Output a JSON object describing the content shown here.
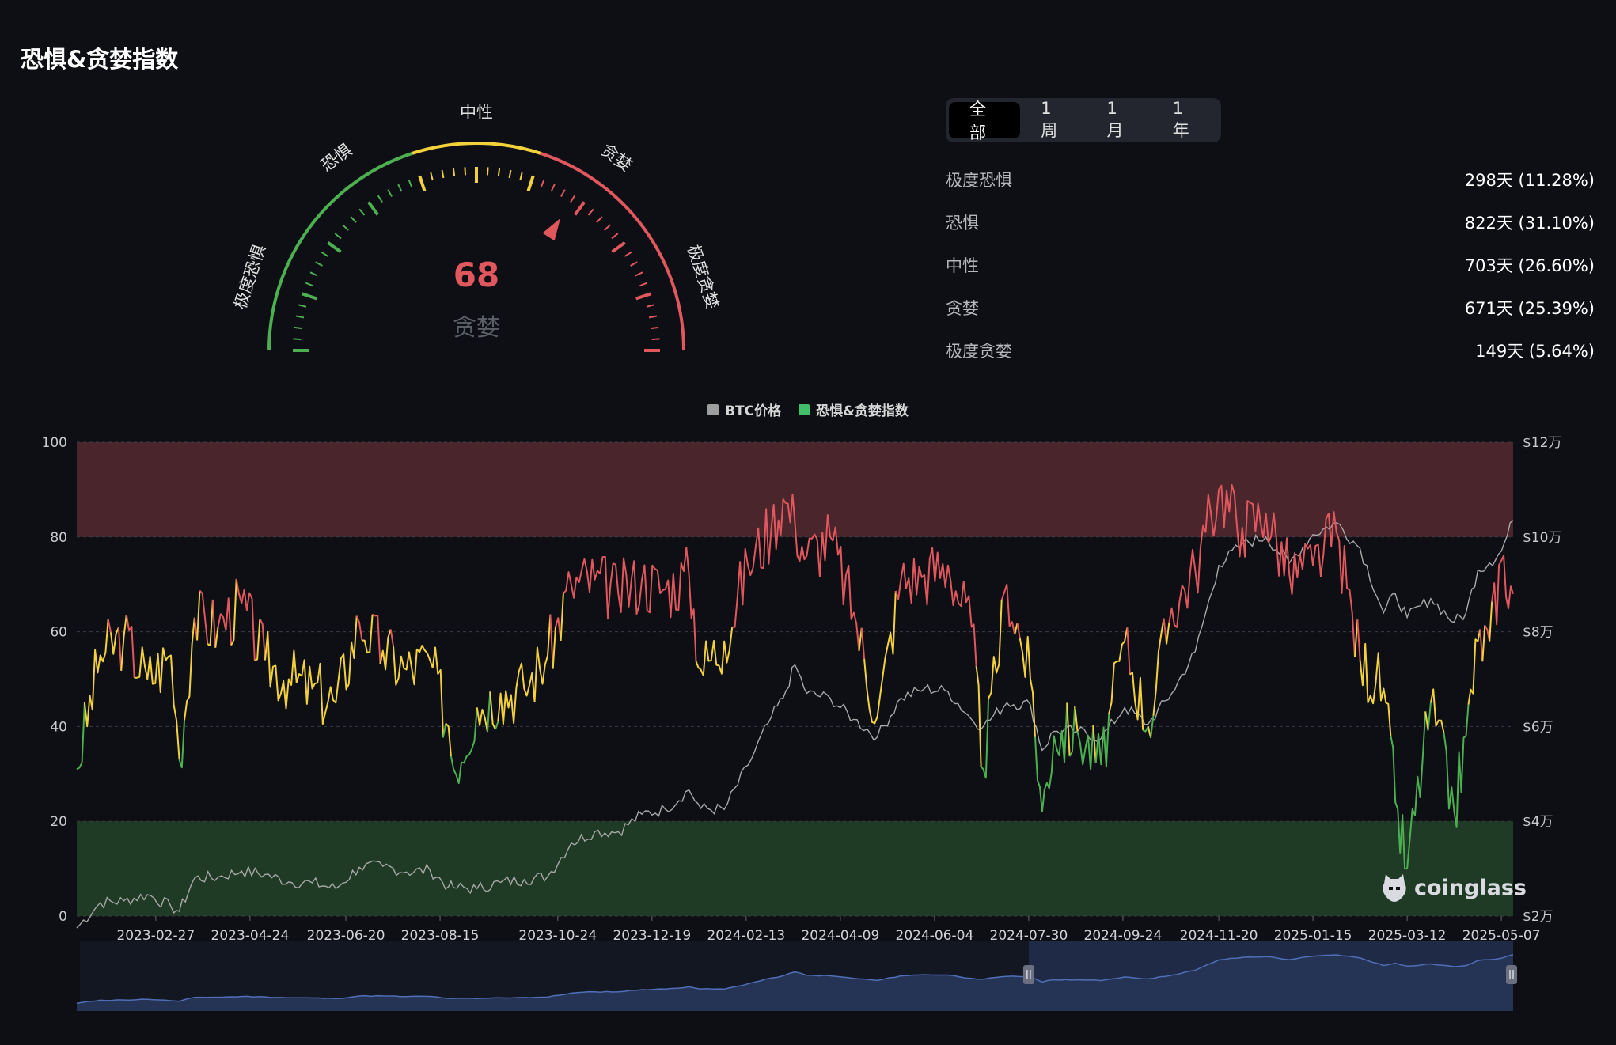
{
  "title": "恐惧&贪婪指数",
  "gauge": {
    "value": 68,
    "value_label": "贪婪",
    "zone_labels": [
      "极度恐惧",
      "恐惧",
      "中性",
      "贪婪",
      "极度贪婪"
    ],
    "colors": {
      "fear": "#4caf50",
      "neutral": "#f2d13d",
      "greed": "#e0575d"
    }
  },
  "tabs": [
    {
      "label": "全部",
      "active": true
    },
    {
      "label": "1周",
      "active": false
    },
    {
      "label": "1月",
      "active": false
    },
    {
      "label": "1年",
      "active": false
    }
  ],
  "stats": [
    {
      "label": "极度恐惧",
      "value": "298天 (11.28%)"
    },
    {
      "label": "恐惧",
      "value": "822天 (31.10%)"
    },
    {
      "label": "中性",
      "value": "703天 (26.60%)"
    },
    {
      "label": "贪婪",
      "value": "671天 (25.39%)"
    },
    {
      "label": "极度贪婪",
      "value": "149天 (5.64%)"
    }
  ],
  "logo_text": "coinglass",
  "chart_data": {
    "type": "line",
    "legend": [
      {
        "name": "BTC价格",
        "color": "#9e9e9e"
      },
      {
        "name": "恐惧&贪婪指数",
        "color": "#3fbf6a"
      }
    ],
    "x_tick_labels": [
      "2023-02-27",
      "2023-04-24",
      "2023-06-20",
      "2023-08-15",
      "2023-10-24",
      "2023-12-19",
      "2024-02-13",
      "2024-04-09",
      "2024-06-04",
      "2024-07-30",
      "2024-09-24",
      "2024-11-20",
      "2025-01-15",
      "2025-03-12",
      "2025-05-07"
    ],
    "y_left": {
      "ticks": [
        "0",
        "20",
        "40",
        "60",
        "80",
        "100"
      ],
      "range": [
        0,
        100
      ]
    },
    "y_right": {
      "ticks": [
        "$2万",
        "$4万",
        "$6万",
        "$8万",
        "$10万",
        "$12万"
      ],
      "range": [
        20000,
        120000
      ]
    },
    "bands": [
      {
        "from": 80,
        "to": 100,
        "color": "#4a252b"
      },
      {
        "from": 0,
        "to": 20,
        "color": "#1f3a25"
      }
    ],
    "color_thresholds": {
      "green_below": 40,
      "red_above": 60,
      "green": "#4caf50",
      "yellow": "#f2d13d",
      "red": "#e0575d"
    },
    "series": [
      {
        "name": "恐惧&贪婪指数",
        "points": [
          [
            "2023-01-11",
            31
          ],
          [
            "2023-01-25",
            55
          ],
          [
            "2023-02-08",
            59
          ],
          [
            "2023-02-22",
            50
          ],
          [
            "2023-03-08",
            55
          ],
          [
            "2023-03-13",
            33
          ],
          [
            "2023-03-22",
            63
          ],
          [
            "2023-04-05",
            61
          ],
          [
            "2023-04-19",
            66
          ],
          [
            "2023-05-03",
            54
          ],
          [
            "2023-05-17",
            50
          ],
          [
            "2023-05-31",
            48
          ],
          [
            "2023-06-14",
            45
          ],
          [
            "2023-06-28",
            62
          ],
          [
            "2023-07-12",
            56
          ],
          [
            "2023-07-26",
            52
          ],
          [
            "2023-08-09",
            54
          ],
          [
            "2023-08-20",
            40
          ],
          [
            "2023-08-23",
            31
          ],
          [
            "2023-09-06",
            44
          ],
          [
            "2023-09-20",
            47
          ],
          [
            "2023-10-04",
            48
          ],
          [
            "2023-10-18",
            55
          ],
          [
            "2023-11-01",
            70
          ],
          [
            "2023-11-15",
            71
          ],
          [
            "2023-11-29",
            68
          ],
          [
            "2023-12-13",
            71
          ],
          [
            "2023-12-27",
            69
          ],
          [
            "2024-01-10",
            72
          ],
          [
            "2024-01-17",
            52
          ],
          [
            "2024-01-31",
            58
          ],
          [
            "2024-02-14",
            74
          ],
          [
            "2024-02-28",
            82
          ],
          [
            "2024-03-06",
            88
          ],
          [
            "2024-03-13",
            83
          ],
          [
            "2024-03-20",
            76
          ],
          [
            "2024-04-03",
            80
          ],
          [
            "2024-04-17",
            64
          ],
          [
            "2024-05-01",
            42
          ],
          [
            "2024-05-15",
            71
          ],
          [
            "2024-05-29",
            72
          ],
          [
            "2024-06-12",
            74
          ],
          [
            "2024-06-26",
            61
          ],
          [
            "2024-07-03",
            31
          ],
          [
            "2024-07-17",
            70
          ],
          [
            "2024-07-31",
            50
          ],
          [
            "2024-08-07",
            22
          ],
          [
            "2024-08-14",
            38
          ],
          [
            "2024-08-28",
            39
          ],
          [
            "2024-09-11",
            32
          ],
          [
            "2024-09-25",
            58
          ],
          [
            "2024-10-09",
            40
          ],
          [
            "2024-10-23",
            65
          ],
          [
            "2024-11-06",
            73
          ],
          [
            "2024-11-20",
            90
          ],
          [
            "2024-12-04",
            82
          ],
          [
            "2024-12-18",
            85
          ],
          [
            "2025-01-01",
            72
          ],
          [
            "2025-01-15",
            74
          ],
          [
            "2025-01-29",
            81
          ],
          [
            "2025-02-12",
            54
          ],
          [
            "2025-02-26",
            48
          ],
          [
            "2025-03-05",
            24
          ],
          [
            "2025-03-12",
            10
          ],
          [
            "2025-03-26",
            45
          ],
          [
            "2025-04-09",
            22
          ],
          [
            "2025-04-16",
            38
          ],
          [
            "2025-04-23",
            58
          ],
          [
            "2025-04-30",
            58
          ],
          [
            "2025-05-07",
            75
          ],
          [
            "2025-05-14",
            68
          ]
        ]
      },
      {
        "name": "BTC价格",
        "points": [
          [
            "2023-01-11",
            17500
          ],
          [
            "2023-01-25",
            22800
          ],
          [
            "2023-02-08",
            23200
          ],
          [
            "2023-02-22",
            24500
          ],
          [
            "2023-03-08",
            22000
          ],
          [
            "2023-03-13",
            21000
          ],
          [
            "2023-03-22",
            28000
          ],
          [
            "2023-04-05",
            28200
          ],
          [
            "2023-04-19",
            29500
          ],
          [
            "2023-05-03",
            28800
          ],
          [
            "2023-05-17",
            27200
          ],
          [
            "2023-05-31",
            27000
          ],
          [
            "2023-06-14",
            25800
          ],
          [
            "2023-06-28",
            30300
          ],
          [
            "2023-07-12",
            30500
          ],
          [
            "2023-07-26",
            29300
          ],
          [
            "2023-08-09",
            29700
          ],
          [
            "2023-08-20",
            26200
          ],
          [
            "2023-08-23",
            26000
          ],
          [
            "2023-09-06",
            25800
          ],
          [
            "2023-09-20",
            27100
          ],
          [
            "2023-10-04",
            27700
          ],
          [
            "2023-10-18",
            28400
          ],
          [
            "2023-11-01",
            35400
          ],
          [
            "2023-11-15",
            37800
          ],
          [
            "2023-11-29",
            37800
          ],
          [
            "2023-12-13",
            41500
          ],
          [
            "2023-12-27",
            42500
          ],
          [
            "2024-01-10",
            46600
          ],
          [
            "2024-01-17",
            42700
          ],
          [
            "2024-01-31",
            42500
          ],
          [
            "2024-02-14",
            51800
          ],
          [
            "2024-02-28",
            62000
          ],
          [
            "2024-03-06",
            66000
          ],
          [
            "2024-03-13",
            73000
          ],
          [
            "2024-03-20",
            67000
          ],
          [
            "2024-04-03",
            66000
          ],
          [
            "2024-04-17",
            61500
          ],
          [
            "2024-05-01",
            57800
          ],
          [
            "2024-05-15",
            66000
          ],
          [
            "2024-05-29",
            68000
          ],
          [
            "2024-06-12",
            67400
          ],
          [
            "2024-06-26",
            61500
          ],
          [
            "2024-07-03",
            60000
          ],
          [
            "2024-07-17",
            65000
          ],
          [
            "2024-07-31",
            64600
          ],
          [
            "2024-08-07",
            55000
          ],
          [
            "2024-08-14",
            59000
          ],
          [
            "2024-08-28",
            59000
          ],
          [
            "2024-09-11",
            57500
          ],
          [
            "2024-09-25",
            64000
          ],
          [
            "2024-10-09",
            60500
          ],
          [
            "2024-10-23",
            67000
          ],
          [
            "2024-11-06",
            75800
          ],
          [
            "2024-11-20",
            94000
          ],
          [
            "2024-12-04",
            98500
          ],
          [
            "2024-12-18",
            100000
          ],
          [
            "2025-01-01",
            94500
          ],
          [
            "2025-01-15",
            100500
          ],
          [
            "2025-01-29",
            103000
          ],
          [
            "2025-02-12",
            97600
          ],
          [
            "2025-02-26",
            84000
          ],
          [
            "2025-03-05",
            88000
          ],
          [
            "2025-03-12",
            83000
          ],
          [
            "2025-03-26",
            87000
          ],
          [
            "2025-04-09",
            82000
          ],
          [
            "2025-04-16",
            84000
          ],
          [
            "2025-04-23",
            93000
          ],
          [
            "2025-04-30",
            94500
          ],
          [
            "2025-05-07",
            97000
          ],
          [
            "2025-05-14",
            103500
          ]
        ]
      }
    ],
    "navigator_selection": [
      "2024-07-30",
      "2025-05-14"
    ]
  }
}
